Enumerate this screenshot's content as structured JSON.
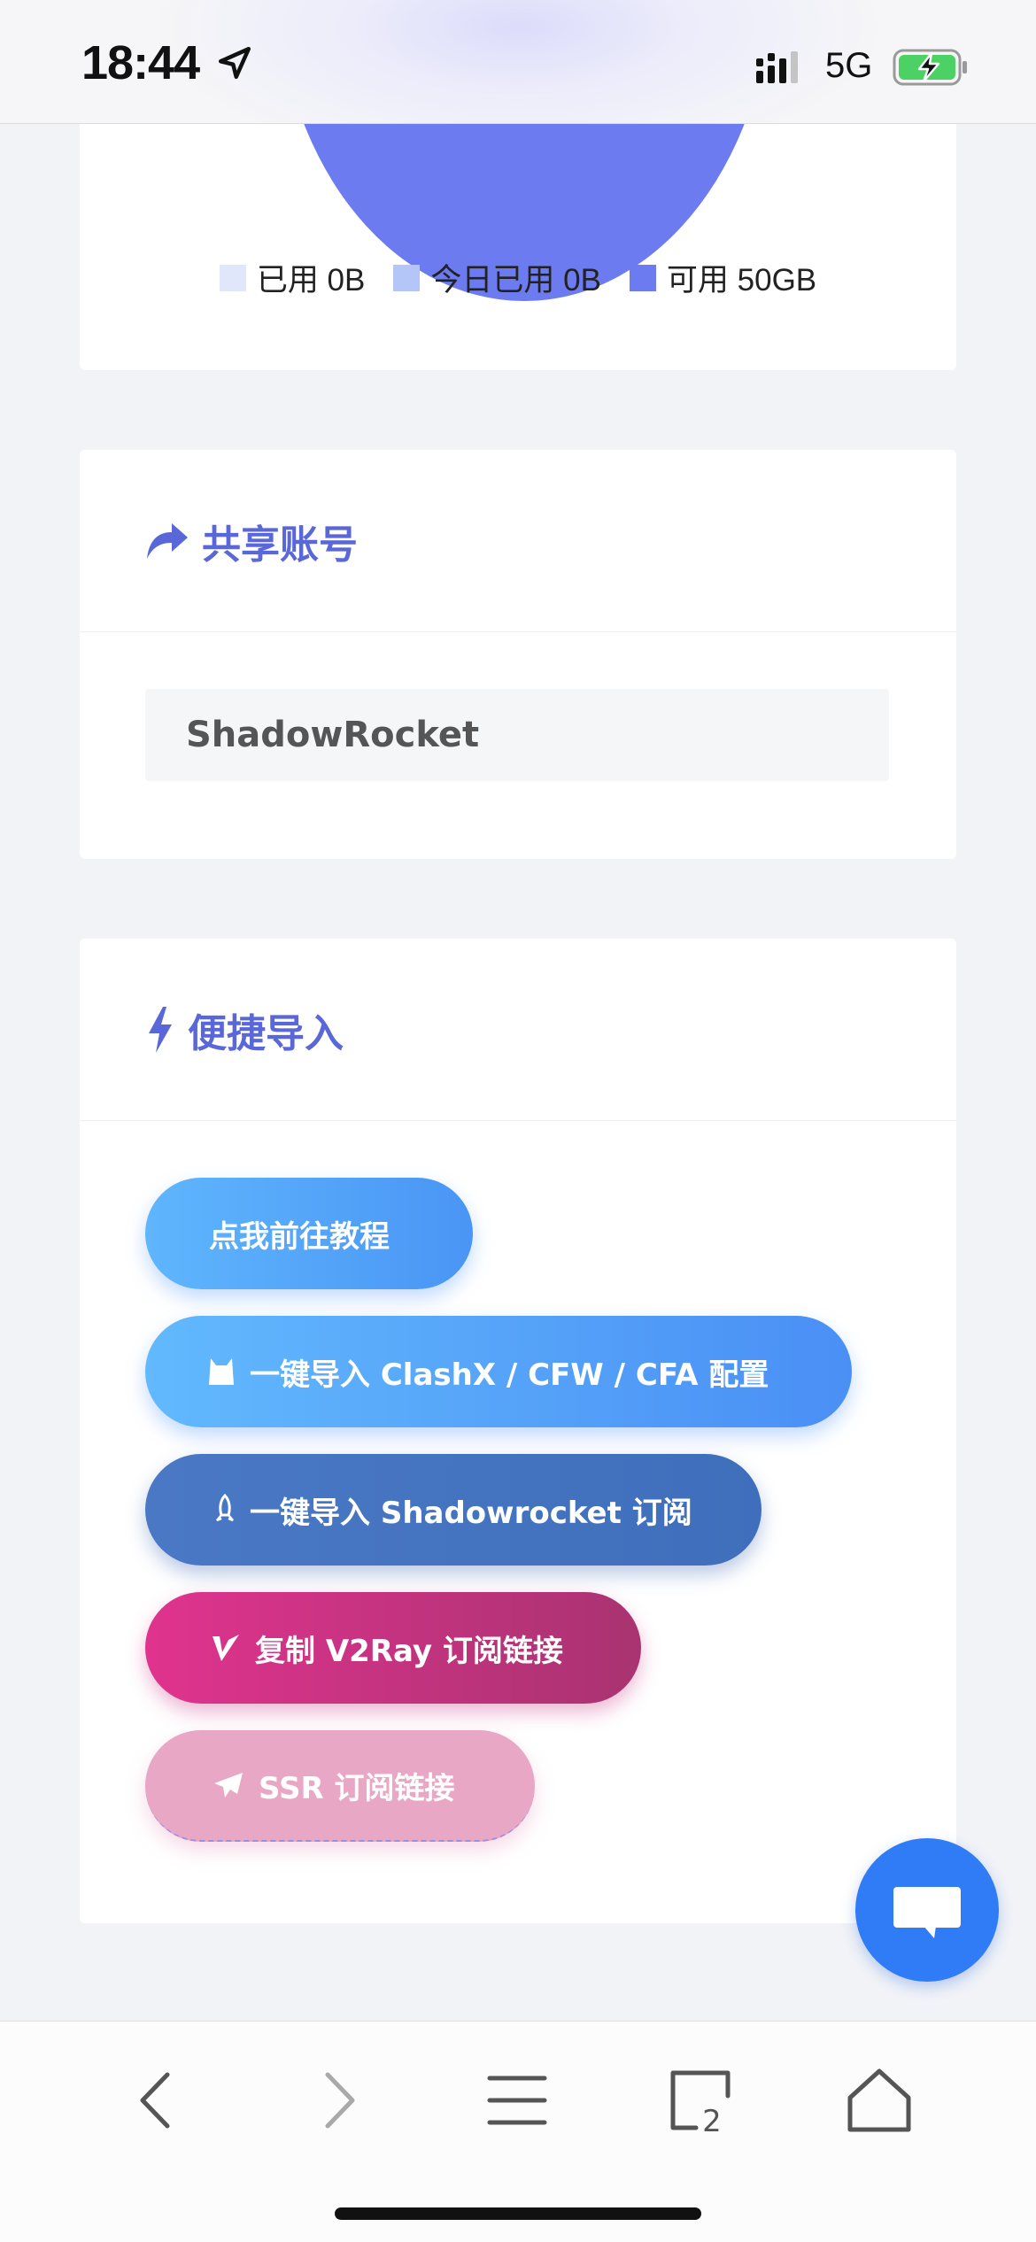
{
  "status_bar": {
    "time": "18:44",
    "network": "5G",
    "icons": [
      "location-arrow-icon",
      "signal-bars-icon",
      "battery-charging-icon"
    ]
  },
  "usage": {
    "legend": [
      {
        "label": "已用 0B",
        "color": "#e1e7fb"
      },
      {
        "label": "今日已用 0B",
        "color": "#b3c6f7"
      },
      {
        "label": "可用 50GB",
        "color": "#6c7bf0"
      }
    ]
  },
  "share_account": {
    "title": "共享账号",
    "icon": "share-forward-icon",
    "field_value": "ShadowRocket"
  },
  "quick_import": {
    "title": "便捷导入",
    "icon": "lightning-bolt-icon",
    "buttons": [
      {
        "label": "点我前往教程",
        "icon": ""
      },
      {
        "label": "一键导入 ClashX / CFW / CFA 配置",
        "icon": "cat-icon"
      },
      {
        "label": "一键导入 Shadowrocket 订阅",
        "icon": "rocket-icon"
      },
      {
        "label": "复制 V2Ray 订阅链接",
        "icon": "v2ray-logo-icon"
      },
      {
        "label": "SSR 订阅链接",
        "icon": "paper-plane-icon"
      }
    ]
  },
  "chat": {
    "icon": "chat-bubble-icon"
  },
  "browser_toolbar": {
    "buttons": [
      "back-icon",
      "forward-icon",
      "menu-icon",
      "tabs-icon",
      "home-icon"
    ],
    "tab_count": "2"
  }
}
